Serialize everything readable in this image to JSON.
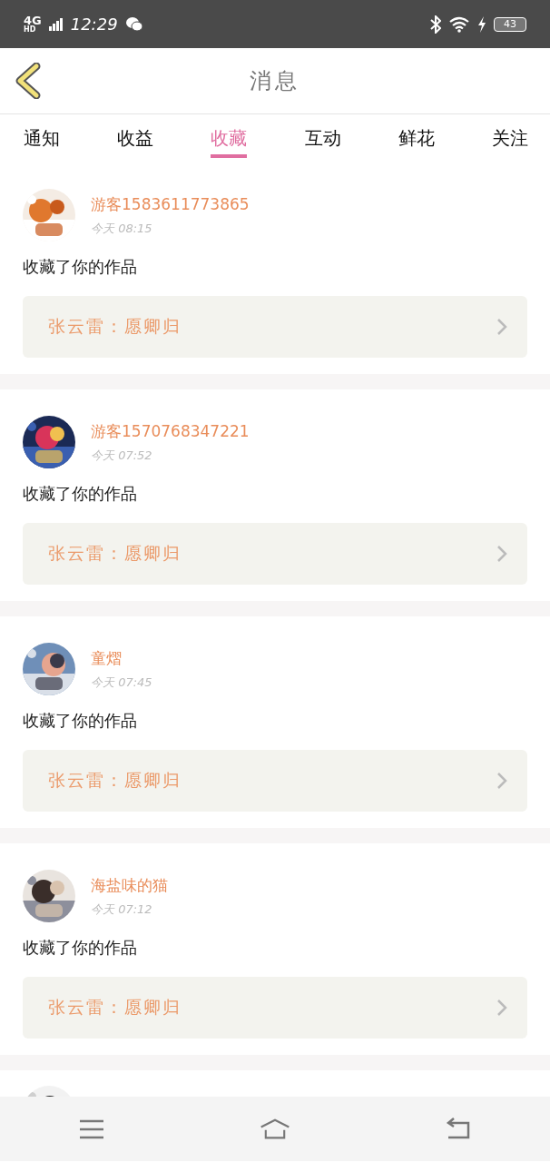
{
  "status_bar": {
    "network": "4G$^{HD}$",
    "time": "12:29",
    "battery": "43"
  },
  "header": {
    "title": "消息"
  },
  "tabs": [
    {
      "label": "通知",
      "selected": false
    },
    {
      "label": "收益",
      "selected": false
    },
    {
      "label": "收藏",
      "selected": true
    },
    {
      "label": "互动",
      "selected": false
    },
    {
      "label": "鲜花",
      "selected": false
    },
    {
      "label": "关注",
      "selected": false
    }
  ],
  "items": [
    {
      "name": "游客1583611773865",
      "time": "今天 08:15",
      "action": "收藏了你的作品",
      "work": "张云雷：愿卿归"
    },
    {
      "name": "游客1570768347221",
      "time": "今天 07:52",
      "action": "收藏了你的作品",
      "work": "张云雷：愿卿归"
    },
    {
      "name": "童熠",
      "time": "今天 07:45",
      "action": "收藏了你的作品",
      "work": "张云雷：愿卿归"
    },
    {
      "name": "海盐味的猫",
      "time": "今天 07:12",
      "action": "收藏了你的作品",
      "work": "张云雷：愿卿归"
    }
  ]
}
